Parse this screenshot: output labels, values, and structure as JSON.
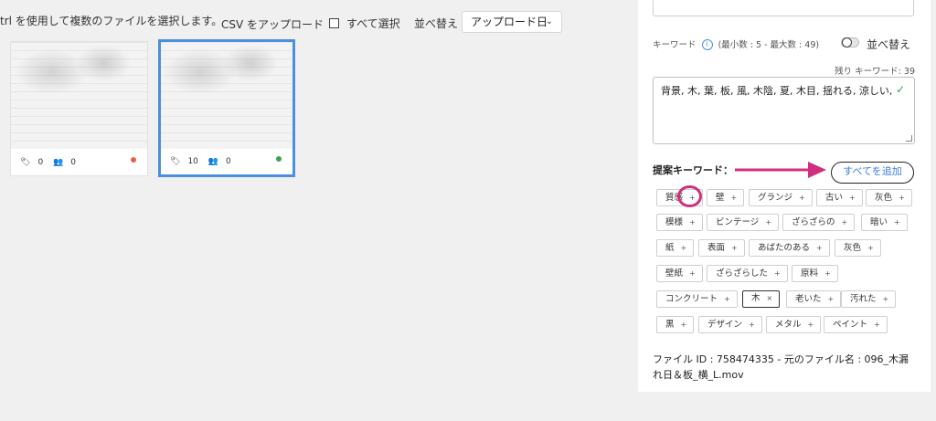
{
  "toolbar": {
    "hint": "trl を使用して複数のファイルを選択します。",
    "csv_upload": "CSV をアップロード",
    "select_all": "すべて選択",
    "sort_label": "並べ替え",
    "sort_value": "アップロード日"
  },
  "thumbnails": [
    {
      "keywords": "0",
      "people": "0",
      "status_color": "#e8614a"
    },
    {
      "keywords": "10",
      "people": "0",
      "status_color": "#3da34d"
    }
  ],
  "panel": {
    "keywords_label": "キーワード",
    "keywords_hint": "(最小数 : 5 - 最大数 : 49)",
    "sort_toggle_label": "並べ替え",
    "remaining": "残り キーワード: 39",
    "keywords_value": "背景, 木, 葉, 板, 風, 木陰, 夏, 木目, 揺れる, 涼しい,",
    "suggested_title": "提案キーワード：",
    "add_all": "すべてを追加",
    "suggested": [
      {
        "label": "質感",
        "sym": "+"
      },
      {
        "label": "壁",
        "sym": "+"
      },
      {
        "label": "グランジ",
        "sym": "+"
      },
      {
        "label": "古い",
        "sym": "+"
      },
      {
        "label": "灰色",
        "sym": "+"
      },
      {
        "label": "模様",
        "sym": "+"
      },
      {
        "label": "ビンテージ",
        "sym": "+"
      },
      {
        "label": "ざらざらの",
        "sym": "+"
      },
      {
        "label": "暗い",
        "sym": "+"
      },
      {
        "label": "紙",
        "sym": "+"
      },
      {
        "label": "表面",
        "sym": "+"
      },
      {
        "label": "あばたのある",
        "sym": "+"
      },
      {
        "label": "灰色",
        "sym": "+"
      },
      {
        "label": "壁紙",
        "sym": "+"
      },
      {
        "label": "ざらざらした",
        "sym": "+"
      },
      {
        "label": "原料",
        "sym": "+"
      },
      {
        "label": "コンクリート",
        "sym": "+"
      },
      {
        "label": "木",
        "sym": "×"
      },
      {
        "label": "老いた",
        "sym": "+"
      },
      {
        "label": "汚れた",
        "sym": "+"
      },
      {
        "label": "黒",
        "sym": "+"
      },
      {
        "label": "デザイン",
        "sym": "+"
      },
      {
        "label": "メタル",
        "sym": "+"
      },
      {
        "label": "ペイント",
        "sym": "+"
      }
    ],
    "file_info": "ファイル ID : 758474335 - 元のファイル名 : 096_木漏れ日＆板_横_L.mov"
  },
  "colors": {
    "accent": "#4a8fe0",
    "highlight": "#cf2f7c",
    "ok": "#2f9e57"
  },
  "icons": [
    "tag-icon",
    "people-icon",
    "info-icon",
    "check-icon",
    "chevron-down-icon"
  ]
}
